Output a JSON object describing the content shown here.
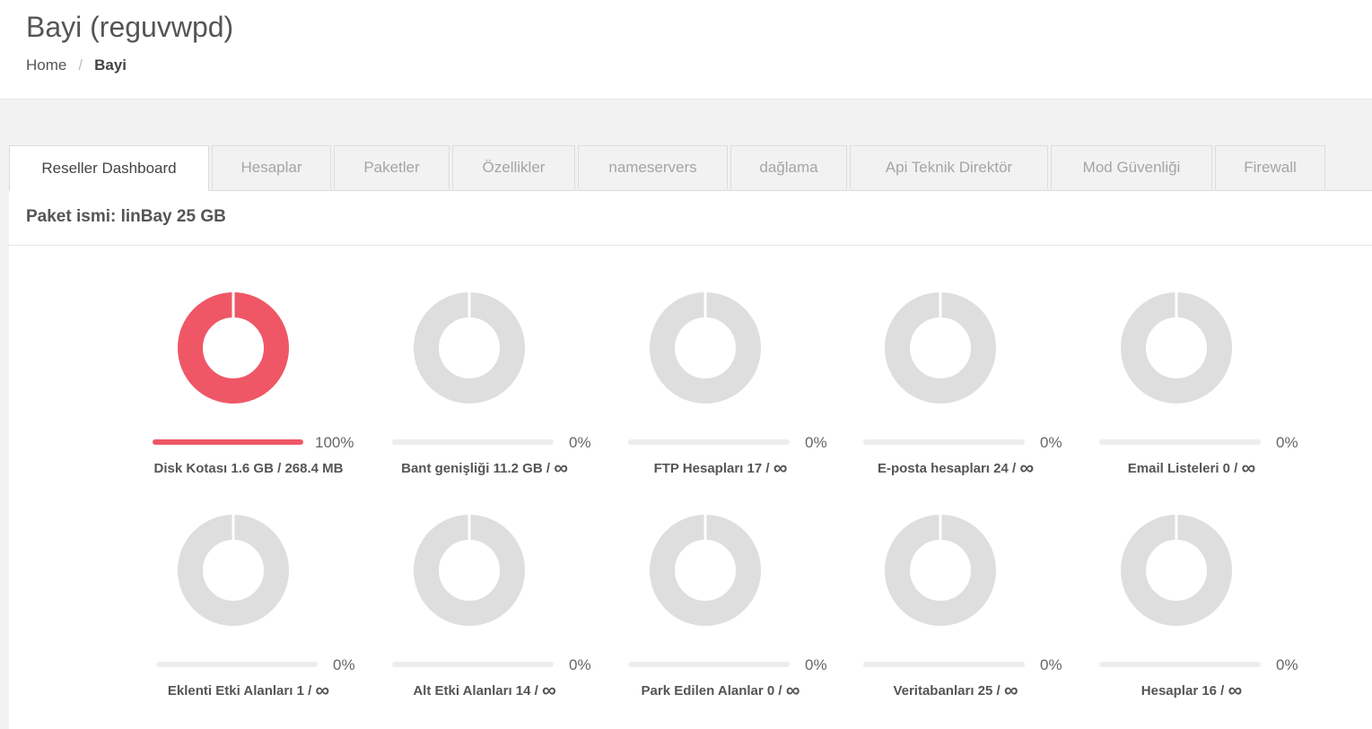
{
  "page": {
    "title": "Bayi (reguvwpd)",
    "breadcrumb": {
      "home": "Home",
      "separator": "/",
      "current": "Bayi"
    }
  },
  "tabs": [
    {
      "label": "Reseller Dashboard",
      "active": true
    },
    {
      "label": "Hesaplar",
      "active": false
    },
    {
      "label": "Paketler",
      "active": false
    },
    {
      "label": "Özellikler",
      "active": false
    },
    {
      "label": "nameservers",
      "active": false
    },
    {
      "label": "dağlama",
      "active": false
    },
    {
      "label": "Api Teknik Direktör",
      "active": false
    },
    {
      "label": "Mod Güvenliği",
      "active": false
    },
    {
      "label": "Firewall",
      "active": false
    }
  ],
  "package": {
    "label": "Paket ismi: linBay 25 GB"
  },
  "colors": {
    "used": "#ef5766",
    "empty": "#dedede",
    "track": "#ededed"
  },
  "stats": [
    {
      "name": "Disk Kotası",
      "value": "1.6 GB",
      "limit": "268.4 MB",
      "percent": 100,
      "percent_label": "100%"
    },
    {
      "name": "Bant genişliği",
      "value": "11.2 GB",
      "limit": "∞",
      "percent": 0,
      "percent_label": "0%"
    },
    {
      "name": "FTP Hesapları",
      "value": "17",
      "limit": "∞",
      "percent": 0,
      "percent_label": "0%"
    },
    {
      "name": "E-posta hesapları",
      "value": "24",
      "limit": "∞",
      "percent": 0,
      "percent_label": "0%"
    },
    {
      "name": "Email Listeleri",
      "value": "0",
      "limit": "∞",
      "percent": 0,
      "percent_label": "0%"
    },
    {
      "name": "Eklenti Etki Alanları",
      "value": "1",
      "limit": "∞",
      "percent": 0,
      "percent_label": "0%"
    },
    {
      "name": "Alt Etki Alanları",
      "value": "14",
      "limit": "∞",
      "percent": 0,
      "percent_label": "0%"
    },
    {
      "name": "Park Edilen Alanlar",
      "value": "0",
      "limit": "∞",
      "percent": 0,
      "percent_label": "0%"
    },
    {
      "name": "Veritabanları",
      "value": "25",
      "limit": "∞",
      "percent": 0,
      "percent_label": "0%"
    },
    {
      "name": "Hesaplar",
      "value": "16",
      "limit": "∞",
      "percent": 0,
      "percent_label": "0%"
    }
  ]
}
